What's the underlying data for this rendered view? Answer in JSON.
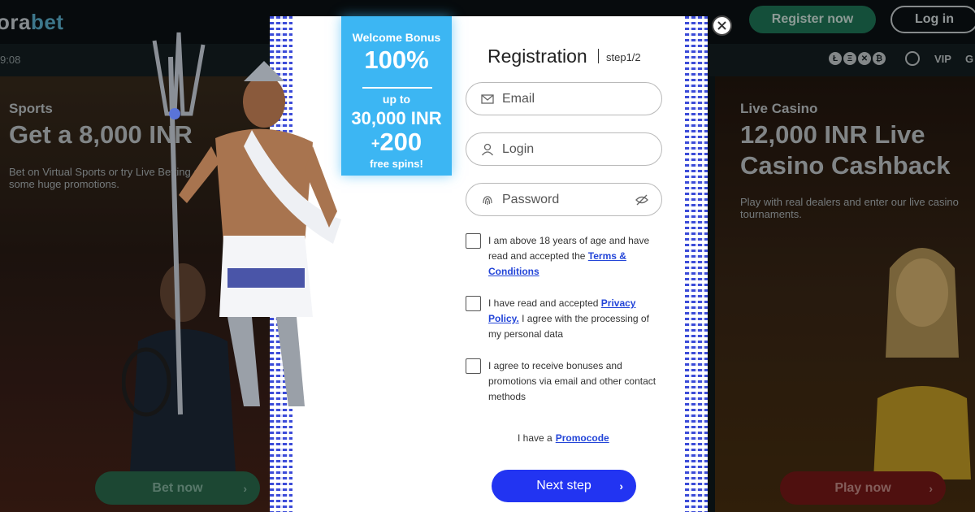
{
  "header": {
    "logo_suffix": "bet",
    "logo_prefix": "ora",
    "register_label": "Register now",
    "login_label": "Log in",
    "clock": "9:08",
    "crypto_icons": [
      "Ł",
      "Ξ",
      "✕",
      "₿"
    ],
    "vip_label": "VIP",
    "more_label": "G"
  },
  "left_promo": {
    "category": "Sports",
    "headline": "Get a 8,000 INR",
    "description_line1": "Bet on Virtual Sports or try Live Betting an",
    "description_line2": "some huge promotions.",
    "button_label": "Bet now"
  },
  "right_promo": {
    "category": "Live Casino",
    "headline_line1": "12,000 INR Live",
    "headline_line2": "Casino Cashback",
    "description_line1": "Play with real dealers and enter our live casino",
    "description_line2": "tournaments.",
    "button_label": "Play now"
  },
  "bonus": {
    "line1": "Welcome Bonus",
    "line2": "100%",
    "line3": "up to",
    "line4": "30,000 INR",
    "plus": "+",
    "line5": "200",
    "line6": "free spins!"
  },
  "registration": {
    "title": "Registration",
    "step": "step1/2",
    "email_placeholder": "Email",
    "login_placeholder": "Login",
    "password_placeholder": "Password",
    "check1_text": "I am above 18 years of age and have read and accepted the",
    "check1_link": "Terms & Conditions",
    "check2_text_before": "I have read and accepted",
    "check2_link": "Privacy Policy.",
    "check2_text_after": "I agree with the processing of my personal data",
    "check3_text": "I agree to receive bonuses and promotions via email and other contact methods",
    "promo_text": "I have a",
    "promo_link": "Promocode",
    "next_label": "Next step"
  },
  "colors": {
    "accent_blue": "#2234f2",
    "bonus_blue": "#3cb6f3",
    "register_green": "#1f7a5a",
    "play_red": "#7a1a17"
  }
}
